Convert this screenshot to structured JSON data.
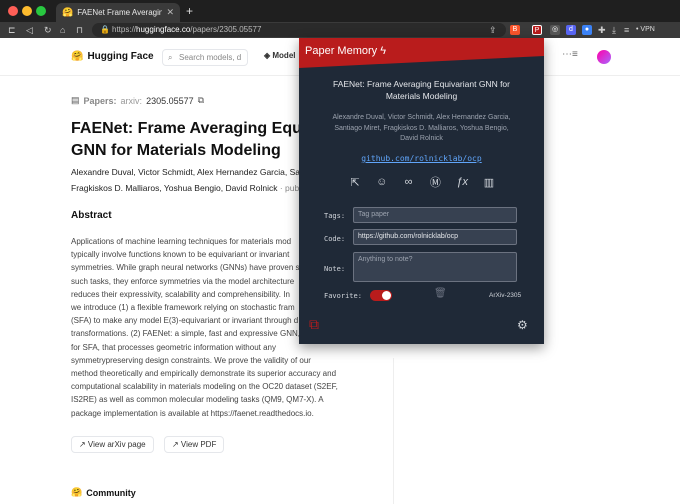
{
  "browser": {
    "tab_title": "FAENet Frame Averaging Equivar",
    "tab_favicon": "hugging-face-icon",
    "url_host": "huggingface.co",
    "url_path": "/papers/2305.05577",
    "url_scheme": "https://",
    "vpn_label": "• VPN"
  },
  "hf": {
    "logo_text": "Hugging Face",
    "search_placeholder": "Search models, d",
    "nav_models": "Model",
    "nav_right": "g",
    "paper_label": "Papers:",
    "arxiv_prefix": "arxiv:",
    "arxiv_id": "2305.05577",
    "title": "FAENet: Frame Averaging Equiva\nGNN for Materials Modeling",
    "authors_line1": "Alexandre Duval,  Victor Schmidt,  Alex Hernandez Garcia,  San",
    "authors_line2": "Fragkiskos D. Malliaros,  Yoshua Bengio,  David Rolnick",
    "published": "·  publi",
    "abstract_heading": "Abstract",
    "abstract_lines": [
      "Applications of machine learning techniques for materials mod",
      "typically involve functions known to be equivariant or invariant",
      "symmetries. While graph neural networks (GNNs) have proven s",
      "such tasks, they enforce symmetries via the model architecture",
      "reduces their expressivity, scalability and comprehensibility. In",
      "we introduce (1) a flexible framework relying on stochastic fram",
      "(SFA) to make any model E(3)-equivariant or invariant through d",
      "transformations. (2) FAENet: a simple, fast and expressive GNN,",
      "for SFA, that processes geometric information without any",
      "symmetrypreserving design constraints. We prove the validity of our",
      "method theoretically and empirically demonstrate its superior accuracy and",
      "computational scalability in materials modeling on the OC20 dataset (S2EF,",
      "IS2RE) as well as common molecular modeling tasks (QM9, QM7-X). A",
      "package implementation is available at https://faenet.readthedocs.io."
    ],
    "view_arxiv": "↗  View arXiv page",
    "view_pdf": "↗  View PDF",
    "community": "Community"
  },
  "popup": {
    "header_title": "Paper Memory ϟ",
    "paper_title": "FAENet: Frame Averaging Equivariant GNN for\nMaterials Modeling",
    "authors": "Alexandre Duval, Victor Schmidt, Alex Hernandez Garcia,\nSantiago Miret, Fragkiskos D. Malliaros, Yoshua Bengio,\nDavid Rolnick",
    "repo_link": "github.com/rolnicklab/ocp",
    "tags_label": "Tags:",
    "tags_placeholder": "Tag paper",
    "code_label": "Code:",
    "code_value": "https://github.com/rolnicklab/ocp",
    "note_label": "Note:",
    "note_placeholder": "Anything to note?",
    "favorite_label": "Favorite:",
    "favorite_on": true,
    "arxiv_tag": "ArXiv-2305",
    "accent_color": "#b91c1c"
  }
}
